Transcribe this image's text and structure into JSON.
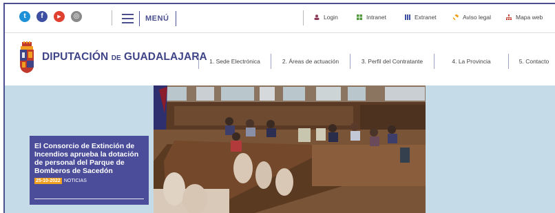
{
  "social": {
    "icons": [
      {
        "name": "twitter-icon",
        "glyph": "t",
        "color": "#1e90d8"
      },
      {
        "name": "facebook-icon",
        "glyph": "f",
        "color": "#3d4fa3"
      },
      {
        "name": "youtube-icon",
        "glyph": "▶",
        "color": "#e0402f"
      },
      {
        "name": "instagram-icon",
        "glyph": "◎",
        "color": "#8a8a8a"
      }
    ]
  },
  "menu": {
    "label": "MENÚ"
  },
  "toplinks": [
    {
      "label": "Login",
      "icon": "user-icon",
      "color": "#8b3a5a"
    },
    {
      "label": "Intranet",
      "icon": "grid-icon",
      "color": "#4f9a3a"
    },
    {
      "label": "Extranet",
      "icon": "columns-icon",
      "color": "#3d4fa3"
    },
    {
      "label": "Aviso legal",
      "icon": "gavel-icon",
      "color": "#f0a01e"
    },
    {
      "label": "Mapa web",
      "icon": "sitemap-icon",
      "color": "#c0392b"
    }
  ],
  "brand": {
    "name_part1": "DIPUTACIÓN",
    "name_de": "DE",
    "name_part2": "GUADALAJARA"
  },
  "nav": [
    {
      "label": "1. Sede Electrónica"
    },
    {
      "label": "2. Áreas de actuación"
    },
    {
      "label": "3. Perfil del Contratante"
    },
    {
      "label": "4. La Provincia"
    },
    {
      "label": "5. Contacto"
    }
  ],
  "news": {
    "title": "El Consorcio de Extinción de Incendios aprueba la dotación de personal del Parque de Bomberos de Sacedón",
    "date": "25-10-2022",
    "category": "NOTICIAS"
  },
  "colors": {
    "brand": "#3f4487",
    "card": "#4b4d9a",
    "date_badge": "#f0a01e",
    "hero_bg": "#c5dce8"
  }
}
